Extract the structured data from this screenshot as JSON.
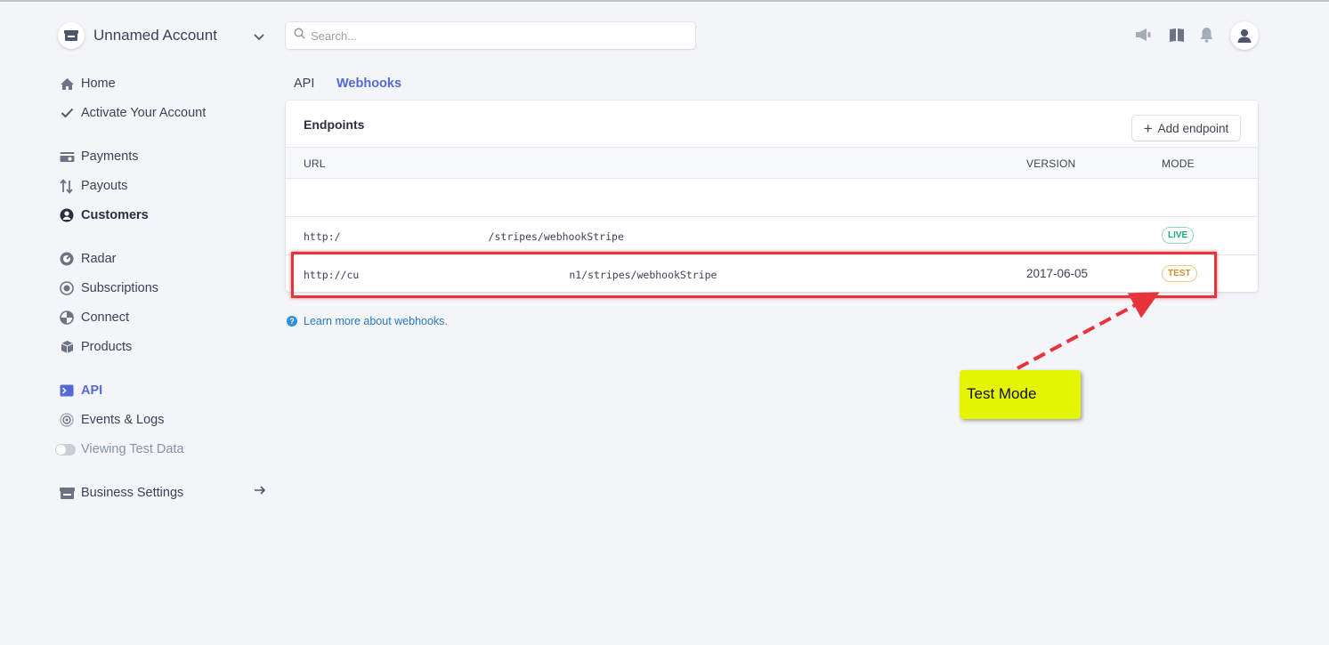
{
  "account": {
    "name": "Unnamed Account"
  },
  "search": {
    "placeholder": "Search..."
  },
  "sidebar": {
    "items": [
      {
        "label": "Home"
      },
      {
        "label": "Activate Your Account"
      },
      {
        "label": "Payments"
      },
      {
        "label": "Payouts"
      },
      {
        "label": "Customers"
      },
      {
        "label": "Radar"
      },
      {
        "label": "Subscriptions"
      },
      {
        "label": "Connect"
      },
      {
        "label": "Products"
      },
      {
        "label": "API"
      },
      {
        "label": "Events & Logs"
      },
      {
        "label": "Viewing Test Data"
      },
      {
        "label": "Business Settings"
      }
    ]
  },
  "tabs": [
    {
      "label": "API"
    },
    {
      "label": "Webhooks"
    }
  ],
  "endpoints": {
    "title": "Endpoints",
    "add_label": "Add endpoint",
    "columns": {
      "url": "URL",
      "version": "VERSION",
      "mode": "MODE"
    },
    "rows": [
      {
        "url_start": "http:/",
        "url_end": "/stripes/webhookStripe",
        "version": "",
        "mode": "LIVE"
      },
      {
        "url_start": "http://cu",
        "url_end": "n1/stripes/webhookStripe",
        "version": "2017-06-05",
        "mode": "TEST"
      }
    ]
  },
  "learn_more": "Learn more about webhooks.",
  "annotation": {
    "callout": "Test Mode"
  },
  "colors": {
    "accent": "#5469d4",
    "live": "#1ea672",
    "test": "#d48b29",
    "highlight": "#e8333b",
    "callout": "#e4f401"
  }
}
